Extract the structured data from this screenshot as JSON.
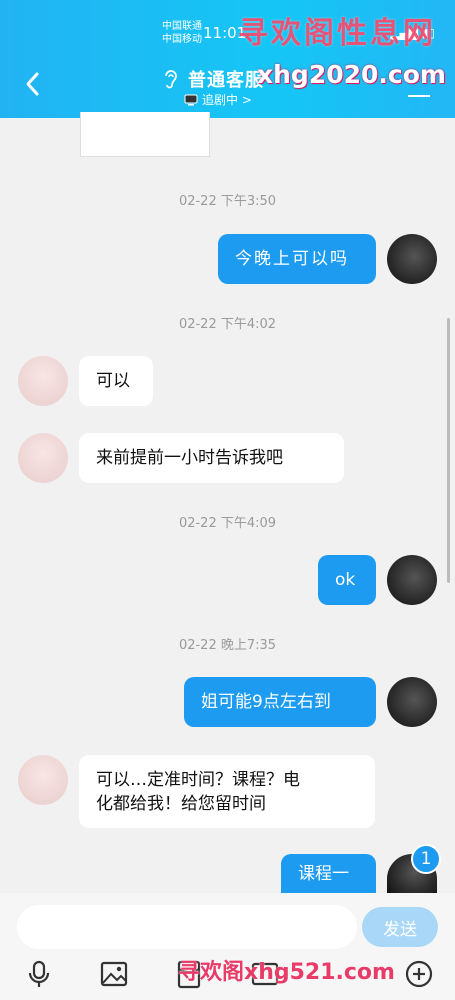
{
  "status_bar": {
    "carrier1": "中国联通",
    "carrier2": "中国移动",
    "time": "11:01"
  },
  "watermark": {
    "top_text": "寻欢阁性息网",
    "top_url": "xhg2020.com",
    "bottom_text": "寻欢阁xhg521.com"
  },
  "header": {
    "contact_name": "普通客服",
    "sub_status": "追剧中 >"
  },
  "messages": [
    {
      "type": "timestamp",
      "text": "02-22 下午3:50"
    },
    {
      "type": "outgoing",
      "text": "今晚上可以吗"
    },
    {
      "type": "timestamp",
      "text": "02-22 下午4:02"
    },
    {
      "type": "incoming",
      "text": "可以"
    },
    {
      "type": "incoming",
      "text": "来前提前一小时告诉我吧"
    },
    {
      "type": "timestamp",
      "text": "02-22 下午4:09"
    },
    {
      "type": "outgoing",
      "text": "ok"
    },
    {
      "type": "timestamp",
      "text": "02-22 晚上7:35"
    },
    {
      "type": "outgoing",
      "text": "姐可能9点左右到"
    },
    {
      "type": "incoming",
      "text": "可以…定准时间？课程？电化都给我！给您留时间"
    },
    {
      "type": "incoming_line2",
      "text": "化都给我！给您留时间"
    },
    {
      "type": "outgoing",
      "text": "课程一"
    }
  ],
  "incoming_multi": {
    "line1": "可以…定准时间？课程？电",
    "line2": "化都给我！给您留时间"
  },
  "unread_badge": "1",
  "input": {
    "placeholder": "",
    "send_label": "发送"
  },
  "colors": {
    "header": "#15c6f5",
    "outgoing_bubble": "#1c9bf0",
    "send_button": "#a8d7f7"
  },
  "icons": [
    "back-icon",
    "ear-icon",
    "tv-icon",
    "menu-icon",
    "mic-icon",
    "image-icon",
    "hongbao-icon",
    "more-icon",
    "plus-icon"
  ]
}
